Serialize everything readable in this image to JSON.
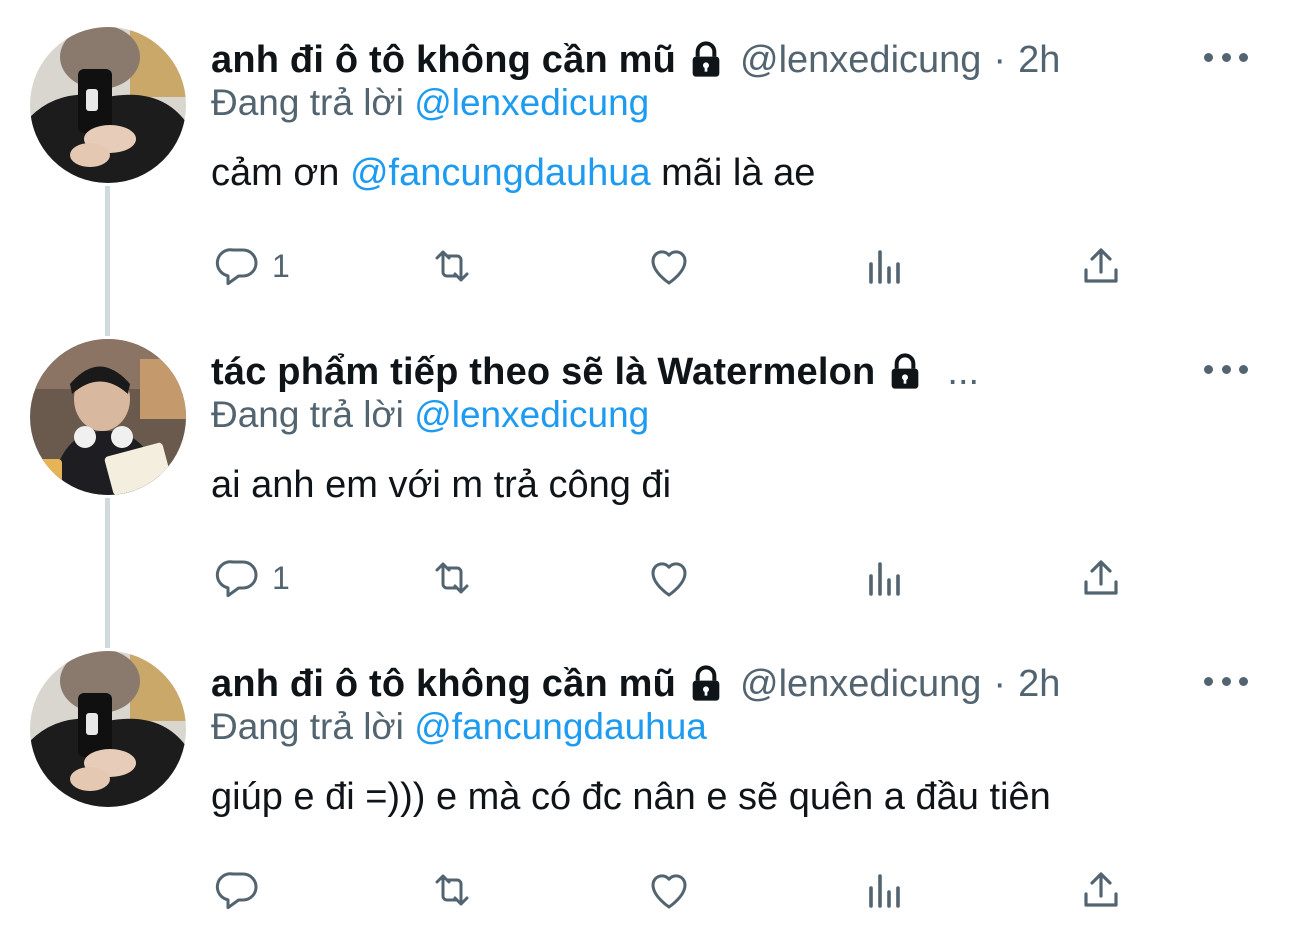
{
  "tweets": [
    {
      "name": "anh đi ô tô không cần mũ",
      "handle": "@lenxedicung",
      "dot": "·",
      "time": "2h",
      "reply_prefix": "Đang trả lời",
      "reply_to": "@lenxedicung",
      "text_before": "cảm ơn",
      "text_mention": "@fancungdauhua",
      "text_after": "mãi là ae",
      "reply_count": "1"
    },
    {
      "name": "tác phẩm tiếp theo sẽ là Watermelon",
      "truncated": "...",
      "reply_prefix": "Đang trả lời",
      "reply_to": "@lenxedicung",
      "text": "ai anh em với m trả công đi",
      "reply_count": "1"
    },
    {
      "name": "anh đi ô tô không cần mũ",
      "handle": "@lenxedicung",
      "dot": "·",
      "time": "2h",
      "reply_prefix": "Đang trả lời",
      "reply_to": "@fancungdauhua",
      "text": "giúp e đi =))) e mà có đc nân e sẽ quên a đầu tiên",
      "reply_count": ""
    }
  ],
  "icons": {
    "lock": "lock-icon",
    "more": "more-icon",
    "reply": "reply-icon",
    "retweet": "retweet-icon",
    "like": "heart-icon",
    "views": "analytics-icon",
    "share": "share-icon"
  },
  "colors": {
    "text": "#0f1419",
    "secondary": "#536471",
    "accent": "#1d9bf0",
    "thread_line": "#cfd9de"
  }
}
